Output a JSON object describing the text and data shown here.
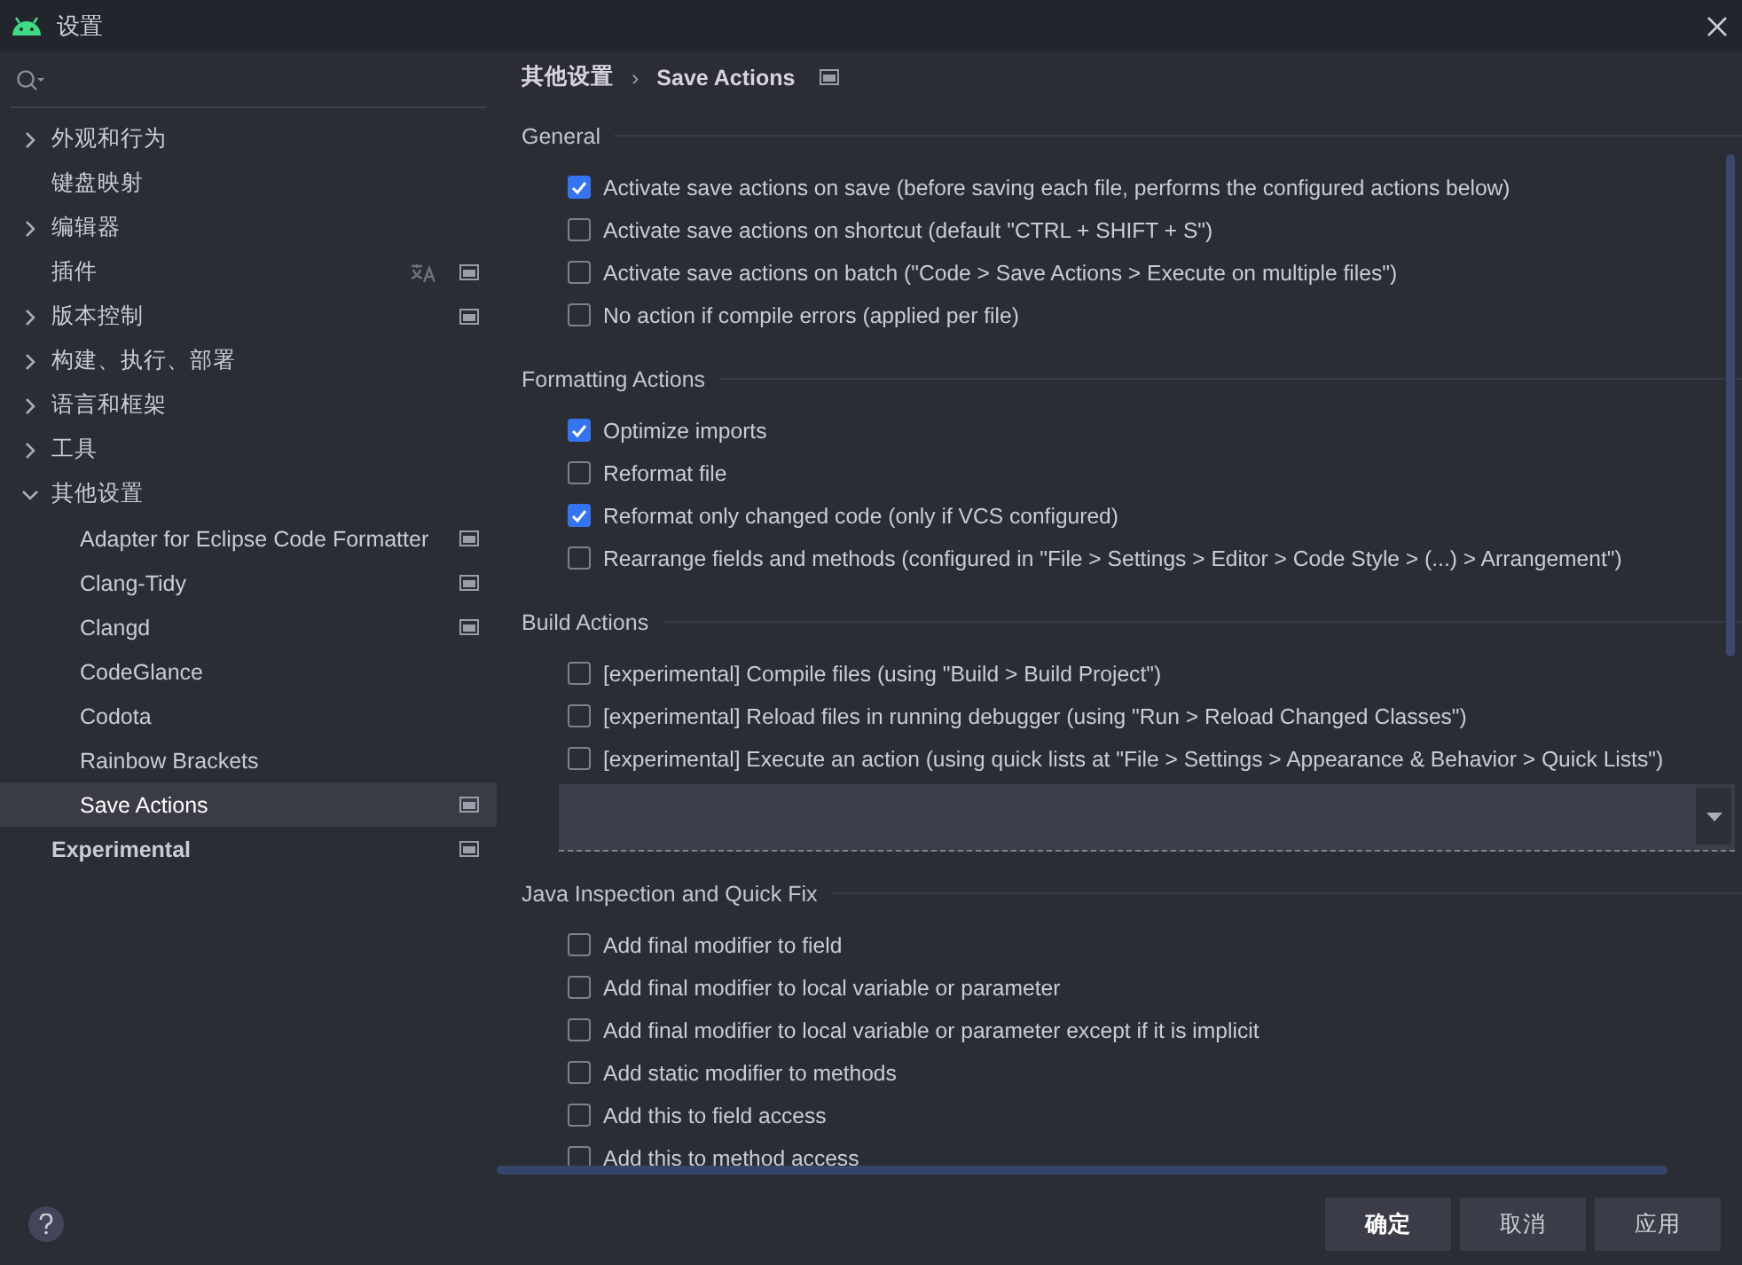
{
  "window": {
    "title": "设置"
  },
  "sidebar": {
    "items": [
      {
        "label": "外观和行为",
        "expanded": false,
        "selected": false
      },
      {
        "label": "键盘映射",
        "selected": false
      },
      {
        "label": "编辑器",
        "expanded": false,
        "selected": false
      },
      {
        "label": "插件",
        "selected": false,
        "language_badge": true,
        "page_badge": true
      },
      {
        "label": "版本控制",
        "expanded": false,
        "selected": false,
        "page_badge": true
      },
      {
        "label": "构建、执行、部署",
        "expanded": false,
        "selected": false
      },
      {
        "label": "语言和框架",
        "expanded": false,
        "selected": false
      },
      {
        "label": "工具",
        "expanded": false,
        "selected": false
      },
      {
        "label": "其他设置",
        "expanded": true,
        "selected": false,
        "children": [
          {
            "label": "Adapter for Eclipse Code Formatter",
            "selected": false,
            "page_badge": true
          },
          {
            "label": "Clang-Tidy",
            "selected": false,
            "page_badge": true
          },
          {
            "label": "Clangd",
            "selected": false,
            "page_badge": true
          },
          {
            "label": "CodeGlance",
            "selected": false
          },
          {
            "label": "Codota",
            "selected": false
          },
          {
            "label": "Rainbow Brackets",
            "selected": false
          },
          {
            "label": "Save Actions",
            "selected": true,
            "page_badge": true
          }
        ]
      },
      {
        "label": "Experimental",
        "selected": false,
        "emphasized": true,
        "page_badge": true
      }
    ]
  },
  "breadcrumb": {
    "items": [
      "其他设置",
      "Save Actions"
    ],
    "separator": "›",
    "page_badge": true
  },
  "sections": [
    {
      "title": "General",
      "options": [
        {
          "kind": "checkbox",
          "label": "Activate save actions on save (before saving each file, performs the configured actions below)",
          "checked": true
        },
        {
          "kind": "checkbox",
          "label": "Activate save actions on shortcut (default \"CTRL + SHIFT + S\")",
          "checked": false
        },
        {
          "kind": "checkbox",
          "label": "Activate save actions on batch (\"Code > Save Actions > Execute on multiple files\")",
          "checked": false
        },
        {
          "kind": "checkbox",
          "label": "No action if compile errors (applied per file)",
          "checked": false
        }
      ]
    },
    {
      "title": "Formatting Actions",
      "options": [
        {
          "kind": "checkbox",
          "label": "Optimize imports",
          "checked": true
        },
        {
          "kind": "checkbox",
          "label": "Reformat file",
          "checked": false
        },
        {
          "kind": "checkbox",
          "label": "Reformat only changed code (only if VCS configured)",
          "checked": true
        },
        {
          "kind": "checkbox",
          "label": "Rearrange fields and methods (configured in \"File > Settings > Editor > Code Style > (...) > Arrangement\")",
          "checked": false
        }
      ]
    },
    {
      "title": "Build Actions",
      "options": [
        {
          "kind": "checkbox",
          "label": "[experimental] Compile files (using \"Build > Build Project\")",
          "checked": false
        },
        {
          "kind": "checkbox",
          "label": "[experimental] Reload files in running debugger (using \"Run > Reload Changed Classes\")",
          "checked": false
        },
        {
          "kind": "checkbox",
          "label": "[experimental] Execute an action (using quick lists at \"File > Settings > Appearance & Behavior > Quick Lists\")",
          "checked": false
        },
        {
          "kind": "dropdown"
        }
      ]
    },
    {
      "title": "Java Inspection and Quick Fix",
      "options": [
        {
          "kind": "checkbox",
          "label": "Add final modifier to field",
          "checked": false
        },
        {
          "kind": "checkbox",
          "label": "Add final modifier to local variable or parameter",
          "checked": false
        },
        {
          "kind": "checkbox",
          "label": "Add final modifier to local variable or parameter except if it is implicit",
          "checked": false
        },
        {
          "kind": "checkbox",
          "label": "Add static modifier to methods",
          "checked": false
        },
        {
          "kind": "checkbox",
          "label": "Add this to field access",
          "checked": false
        },
        {
          "kind": "checkbox",
          "label": "Add this to method access",
          "checked": false
        }
      ]
    }
  ],
  "buttons": [
    {
      "label": "确定",
      "primary": true
    },
    {
      "label": "取消",
      "primary": false
    },
    {
      "label": "应用",
      "primary": false
    }
  ]
}
